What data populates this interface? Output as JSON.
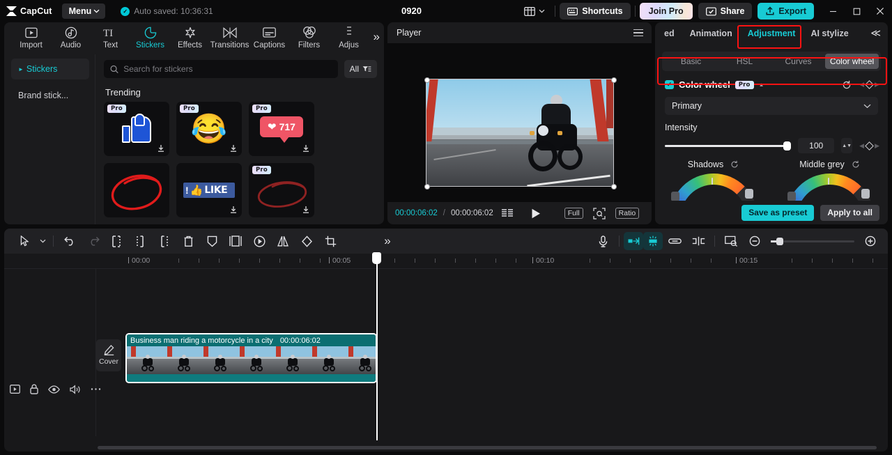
{
  "titlebar": {
    "brand": "CapCut",
    "menu_label": "Menu",
    "autosave_text": "Auto saved: 10:36:31",
    "project_title": "0920",
    "shortcuts_label": "Shortcuts",
    "join_pro_label": "Join Pro",
    "share_label": "Share",
    "export_label": "Export",
    "minimize": "–",
    "maximize": "□",
    "close": "✕",
    "accent_color": "#18cbd4"
  },
  "function_tabs": [
    {
      "label": "Import",
      "icon": "import-icon",
      "active": false
    },
    {
      "label": "Audio",
      "icon": "audio-icon",
      "active": false
    },
    {
      "label": "Text",
      "icon": "text-icon",
      "active": false
    },
    {
      "label": "Stickers",
      "icon": "stickers-icon",
      "active": true
    },
    {
      "label": "Effects",
      "icon": "effects-icon",
      "active": false
    },
    {
      "label": "Transitions",
      "icon": "transitions-icon",
      "active": false
    },
    {
      "label": "Captions",
      "icon": "captions-icon",
      "active": false
    },
    {
      "label": "Filters",
      "icon": "filters-icon",
      "active": false
    },
    {
      "label": "Adjus",
      "icon": "adjustment-icon",
      "active": false
    }
  ],
  "function_tabs_more": "»",
  "left_panel": {
    "categories": [
      {
        "label": "Stickers",
        "active": true
      },
      {
        "label": "Brand stick...",
        "active": false
      }
    ],
    "search_placeholder": "Search for stickers",
    "search_value": "",
    "filter_label": "All",
    "section_title": "Trending",
    "stickers": [
      {
        "name": "thumbs-up-sticker",
        "pro": true,
        "art": "thumbsup",
        "downloadable": true
      },
      {
        "name": "laughing-emoji-sticker",
        "pro": true,
        "art": "lol",
        "emoji": "😂",
        "downloadable": true
      },
      {
        "name": "heart-count-sticker",
        "pro": true,
        "art": "heart",
        "count": "717",
        "downloadable": true
      },
      {
        "name": "red-circle-scribble-sticker",
        "pro": false,
        "art": "scribble-red",
        "downloadable": false
      },
      {
        "name": "like-banner-sticker",
        "pro": false,
        "art": "like-banner",
        "label": "LIKE",
        "downloadable": true
      },
      {
        "name": "dark-red-ellipse-sticker",
        "pro": true,
        "art": "scribble-darkred",
        "downloadable": true
      }
    ]
  },
  "player": {
    "title": "Player",
    "current_time": "00:00:06:02",
    "separator": "/",
    "total_time": "00:00:06:02",
    "full_label": "Full",
    "ratio_label": "Ratio"
  },
  "right_panel": {
    "tabs": [
      {
        "label": "ed",
        "active": false
      },
      {
        "label": "Animation",
        "active": false
      },
      {
        "label": "Adjustment",
        "active": true,
        "highlighted": true
      },
      {
        "label": "AI stylize",
        "active": false
      }
    ],
    "collapse_icon": "≪",
    "subtabs": [
      {
        "label": "Basic",
        "active": false
      },
      {
        "label": "HSL",
        "active": false
      },
      {
        "label": "Curves",
        "active": false
      },
      {
        "label": "Color wheel",
        "active": true
      }
    ],
    "color_wheel": {
      "title": "Color wheel",
      "pro_badge": "Pro",
      "enabled": true,
      "mode_value": "Primary",
      "intensity_label": "Intensity",
      "intensity_value": "100",
      "intensity_percent": 100,
      "wheels": [
        {
          "label": "Shadows"
        },
        {
          "label": "Middle grey"
        }
      ]
    },
    "save_preset_label": "Save as preset",
    "apply_all_label": "Apply to all",
    "highlight_color": "#fb1212"
  },
  "timeline": {
    "toolbar_left": [
      {
        "name": "select-tool-icon"
      },
      {
        "name": "chevron-down-icon"
      },
      {
        "name": "undo-icon"
      },
      {
        "name": "redo-icon"
      },
      {
        "name": "split-icon"
      },
      {
        "name": "trim-left-icon"
      },
      {
        "name": "trim-right-icon"
      },
      {
        "name": "delete-icon"
      },
      {
        "name": "keyframe-shield-icon"
      },
      {
        "name": "freeze-frame-icon"
      },
      {
        "name": "speed-icon"
      },
      {
        "name": "mirror-icon"
      },
      {
        "name": "rotate-icon"
      },
      {
        "name": "crop-icon"
      },
      {
        "name": "more-tools-icon"
      }
    ],
    "toolbar_right": [
      {
        "name": "record-voiceover-icon"
      },
      {
        "name": "auto-snap-icon",
        "active": true
      },
      {
        "name": "magnet-snap-icon",
        "active": true
      },
      {
        "name": "link-clips-icon"
      },
      {
        "name": "split-track-icon"
      },
      {
        "name": "preview-scale-icon"
      },
      {
        "name": "zoom-out-icon"
      },
      {
        "name": "zoom-in-icon"
      }
    ],
    "ruler_labels": [
      "00:00",
      "00:05",
      "00:10",
      "00:15"
    ],
    "clip_controls": [
      {
        "name": "clip-preview-toggle-icon"
      },
      {
        "name": "lock-icon"
      },
      {
        "name": "eye-icon"
      },
      {
        "name": "volume-icon"
      },
      {
        "name": "more-options-icon"
      }
    ],
    "cover_label": "Cover",
    "clip": {
      "name": "Business man riding a motorcycle in a city",
      "duration": "00:00:06:02"
    }
  }
}
